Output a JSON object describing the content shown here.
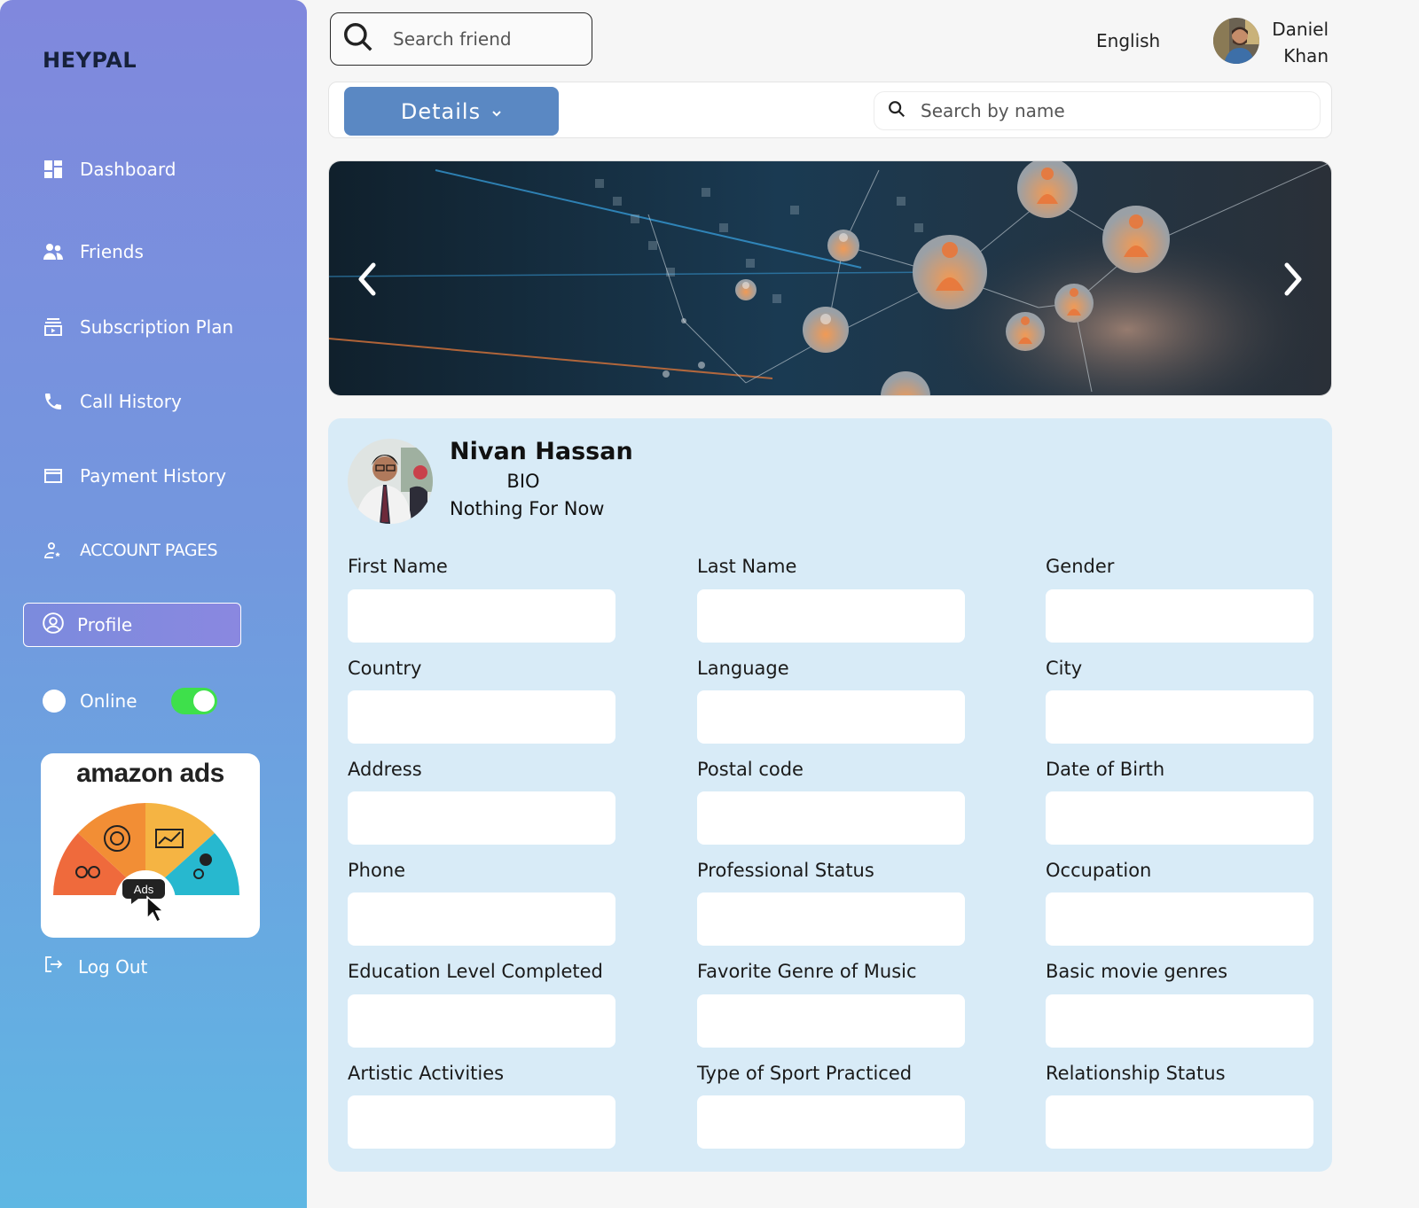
{
  "brand": "HEYPAL",
  "sidebar": {
    "items": [
      {
        "label": "Dashboard",
        "icon": "dashboard-icon"
      },
      {
        "label": "Friends",
        "icon": "friends-icon"
      },
      {
        "label": "Subscription Plan",
        "icon": "subscription-icon"
      },
      {
        "label": "Call History",
        "icon": "phone-icon"
      },
      {
        "label": "Payment History",
        "icon": "credit-card-icon"
      },
      {
        "label": "ACCOUNT PAGES",
        "icon": "account-icon"
      }
    ],
    "profile_label": "Profile",
    "online_label": "Online",
    "online_toggle": true,
    "logout_label": "Log Out",
    "ad": {
      "title": "amazon ads",
      "badge": "Ads"
    }
  },
  "header": {
    "search_placeholder": "Search friend",
    "language": "English",
    "user_first": "Daniel",
    "user_last": "Khan"
  },
  "filter": {
    "details_label": "Details",
    "search_placeholder": "Search by name"
  },
  "profile": {
    "name": "Nivan Hassan",
    "bio_label": "BIO",
    "bio": "Nothing For Now",
    "fields": [
      {
        "label": "First Name",
        "value": ""
      },
      {
        "label": "Last Name",
        "value": ""
      },
      {
        "label": "Gender",
        "value": ""
      },
      {
        "label": "Country",
        "value": ""
      },
      {
        "label": "Language",
        "value": ""
      },
      {
        "label": "City",
        "value": ""
      },
      {
        "label": "Address",
        "value": ""
      },
      {
        "label": "Postal code",
        "value": ""
      },
      {
        "label": "Date of Birth",
        "value": ""
      },
      {
        "label": "Phone",
        "value": ""
      },
      {
        "label": "Professional Status",
        "value": ""
      },
      {
        "label": "Occupation",
        "value": ""
      },
      {
        "label": "Education Level Completed",
        "value": ""
      },
      {
        "label": "Favorite Genre of Music",
        "value": ""
      },
      {
        "label": "Basic movie genres",
        "value": ""
      },
      {
        "label": "Artistic Activities",
        "value": ""
      },
      {
        "label": "Type of Sport Practiced",
        "value": ""
      },
      {
        "label": "Relationship Status",
        "value": ""
      }
    ]
  },
  "colors": {
    "sidebar_top": "#8088dd",
    "sidebar_bottom": "#5fb7e3",
    "details_button": "#5a88c3",
    "panel_bg": "#d8ebf7",
    "toggle_on": "#3ee04b"
  }
}
